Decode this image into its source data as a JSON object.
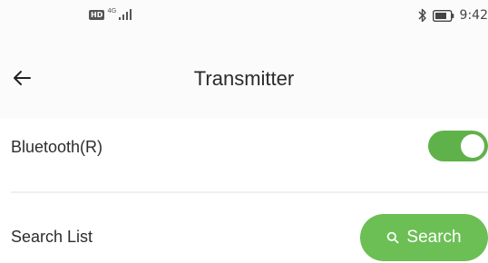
{
  "status_bar": {
    "network_badge": "HD",
    "network_type": "4G",
    "time": "9:42"
  },
  "header": {
    "title": "Transmitter",
    "back_icon": "arrow-left-icon"
  },
  "settings": {
    "bluetooth": {
      "label": "Bluetooth(R)",
      "enabled": true
    },
    "search_list": {
      "label": "Search List",
      "button_label": "Search",
      "button_icon": "search-icon"
    }
  },
  "colors": {
    "accent": "#5fb24a",
    "button": "#6cbf55"
  }
}
